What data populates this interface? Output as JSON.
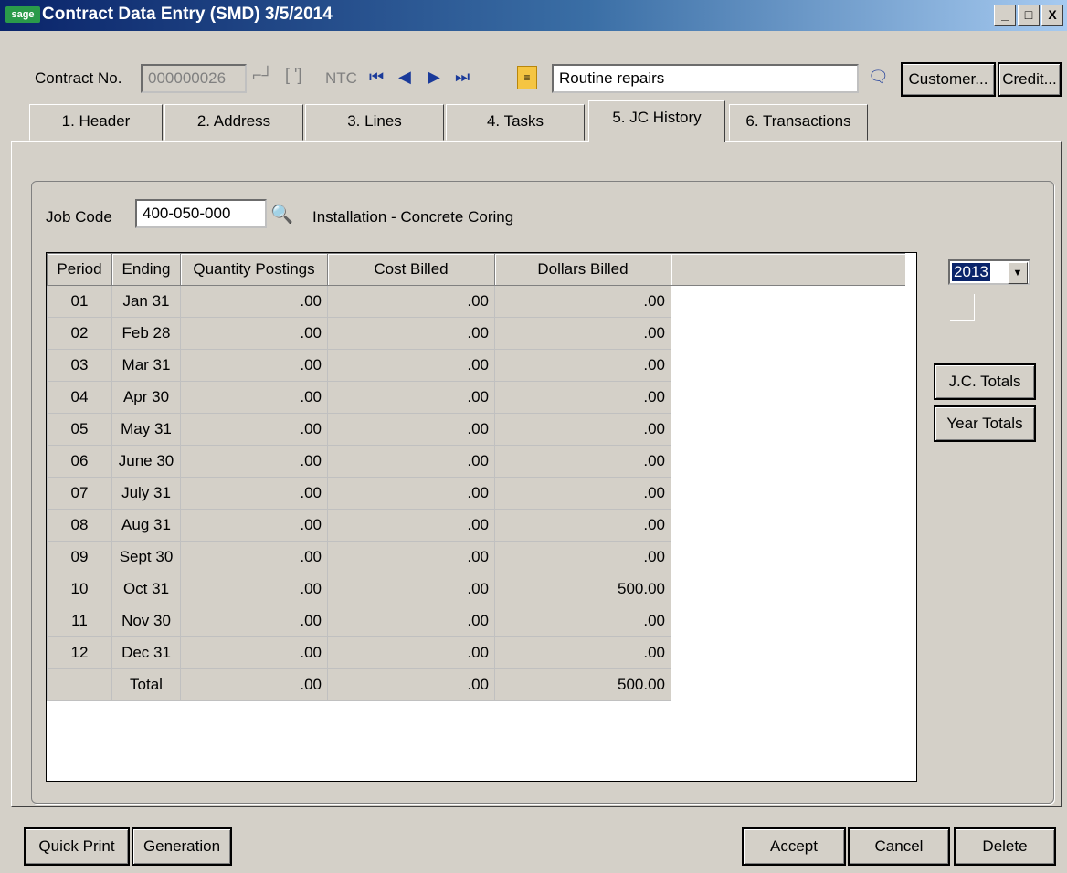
{
  "window": {
    "logo": "sage",
    "title": "Contract Data Entry (SMD) 3/5/2014",
    "minimize": "_",
    "maximize": "□",
    "close": "X"
  },
  "toolbar": {
    "contract_label": "Contract No.",
    "contract_value": "000000026",
    "ntc": "NTC",
    "description": "Routine repairs",
    "customer_button": "Customer...",
    "credit_button": "Credit..."
  },
  "icons": {
    "first": "first-record-icon",
    "prev": "previous-record-icon",
    "next": "next-record-icon",
    "last": "last-record-icon",
    "notes": "memo-icon",
    "lookup": "magnifier-icon",
    "chat": "comment-icon"
  },
  "tabs": [
    "1. Header",
    "2. Address",
    "3. Lines",
    "4. Tasks",
    "5. JC History",
    "6. Transactions"
  ],
  "active_tab": "5. JC History",
  "jobcode": {
    "label": "Job Code",
    "value": "400-050-000",
    "description": "Installation - Concrete Coring"
  },
  "year": "2013",
  "side_buttons": {
    "jc_totals": "J.C. Totals",
    "year_totals": "Year Totals"
  },
  "grid": {
    "columns": [
      "Period",
      "Ending",
      "Quantity Postings",
      "Cost Billed",
      "Dollars Billed"
    ],
    "rows": [
      [
        "01",
        "Jan 31",
        ".00",
        ".00",
        ".00"
      ],
      [
        "02",
        "Feb 28",
        ".00",
        ".00",
        ".00"
      ],
      [
        "03",
        "Mar 31",
        ".00",
        ".00",
        ".00"
      ],
      [
        "04",
        "Apr 30",
        ".00",
        ".00",
        ".00"
      ],
      [
        "05",
        "May 31",
        ".00",
        ".00",
        ".00"
      ],
      [
        "06",
        "June 30",
        ".00",
        ".00",
        ".00"
      ],
      [
        "07",
        "July 31",
        ".00",
        ".00",
        ".00"
      ],
      [
        "08",
        "Aug 31",
        ".00",
        ".00",
        ".00"
      ],
      [
        "09",
        "Sept 30",
        ".00",
        ".00",
        ".00"
      ],
      [
        "10",
        "Oct 31",
        ".00",
        ".00",
        "500.00"
      ],
      [
        "11",
        "Nov 30",
        ".00",
        ".00",
        ".00"
      ],
      [
        "12",
        "Dec 31",
        ".00",
        ".00",
        ".00"
      ],
      [
        "",
        "Total",
        ".00",
        ".00",
        "500.00"
      ]
    ]
  },
  "footer": {
    "quick_print": "Quick Print",
    "generation": "Generation",
    "accept": "Accept",
    "cancel": "Cancel",
    "delete": "Delete"
  }
}
